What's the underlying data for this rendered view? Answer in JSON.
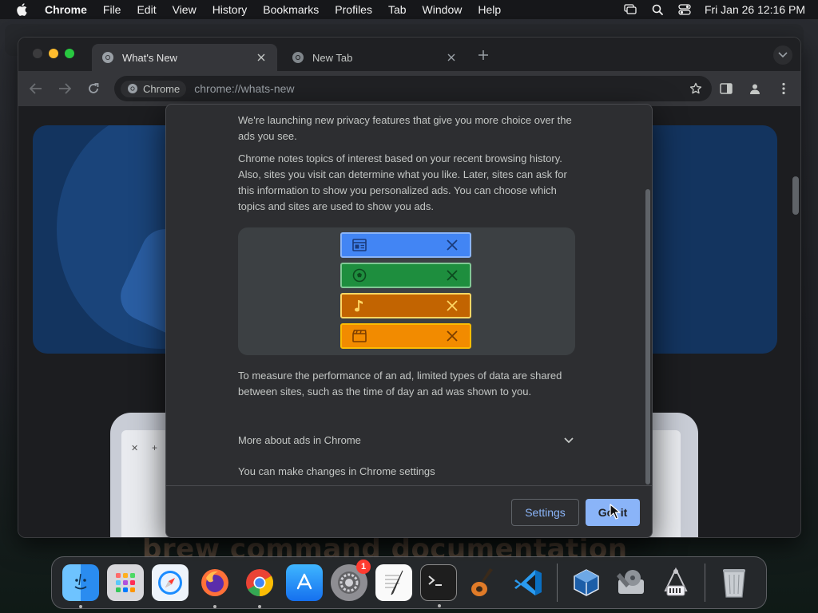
{
  "menubar": {
    "app_name": "Chrome",
    "items": [
      "File",
      "Edit",
      "View",
      "History",
      "Bookmarks",
      "Profiles",
      "Tab",
      "Window",
      "Help"
    ],
    "clock": "Fri Jan 26  12:16 PM"
  },
  "tabs": [
    {
      "label": "What's New",
      "active": true
    },
    {
      "label": "New Tab",
      "active": false
    }
  ],
  "omnibox": {
    "chip_label": "Chrome",
    "url": "chrome://whats-new"
  },
  "dialog": {
    "intro": "We're launching new privacy features that give you more choice over the ads you see.",
    "topics_paragraph": "Chrome notes topics of interest based on your recent browsing history. Also, sites you visit can determine what you like. Later, sites can ask for this information to show you personalized ads. You can choose which topics and sites are used to show you ads.",
    "topics": [
      {
        "icon": "newspaper-icon",
        "color": "#4285f4"
      },
      {
        "icon": "soccer-ball-icon",
        "color": "#1e8e3e"
      },
      {
        "icon": "music-note-icon",
        "color": "#e37400"
      },
      {
        "icon": "clapperboard-icon",
        "color": "#f28b00"
      }
    ],
    "measurement_paragraph": "To measure the performance of an ad, limited types of data are shared between sites, such as the time of day an ad was shown to you.",
    "expand_label": "More about ads in Chrome",
    "settings_note": "You can make changes in Chrome settings",
    "settings_button": "Settings",
    "gotit_button": "Got it"
  },
  "background_text": "brew command documentation",
  "dock": {
    "apps": [
      "Finder",
      "Launchpad",
      "Safari",
      "Firefox",
      "Chrome",
      "App Store",
      "System Settings",
      "TextEdit",
      "Terminal",
      "GarageBand",
      "Visual Studio Code",
      "VirtualBox",
      "Disk Utility",
      "System Information",
      "Trash"
    ],
    "settings_badge": "1"
  },
  "colors": {
    "accent": "#8ab4f8",
    "dialog_bg": "#2d2e31",
    "window_bg": "#202124"
  }
}
